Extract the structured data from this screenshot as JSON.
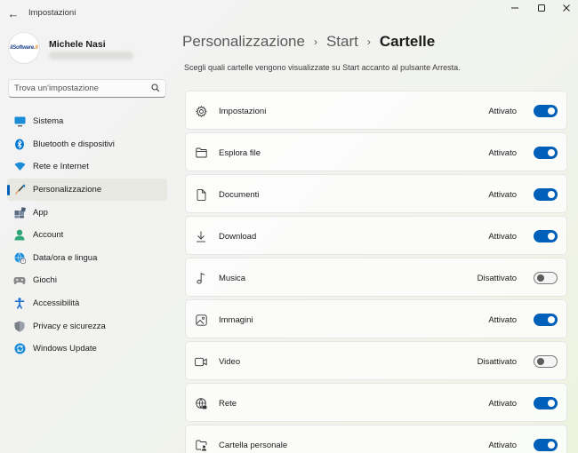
{
  "window": {
    "title": "Impostazioni",
    "back_icon": "arrow-left-icon"
  },
  "profile": {
    "name": "Michele Nasi",
    "logo_text": "ilSoftware",
    "logo_dot": ".it"
  },
  "search": {
    "placeholder": "Trova un'impostazione",
    "value": ""
  },
  "nav": {
    "items": [
      {
        "label": "Sistema",
        "icon": "monitor-icon",
        "color": "#0078d4"
      },
      {
        "label": "Bluetooth e dispositivi",
        "icon": "bluetooth-icon",
        "color": "#0078d4"
      },
      {
        "label": "Rete e Internet",
        "icon": "wifi-icon",
        "color": "#1a8cd8"
      },
      {
        "label": "Personalizzazione",
        "icon": "paintbrush-icon",
        "color": "#e07a2e",
        "active": true
      },
      {
        "label": "App",
        "icon": "apps-icon",
        "color": "#5a6b82"
      },
      {
        "label": "Account",
        "icon": "person-icon",
        "color": "#2fa57a"
      },
      {
        "label": "Data/ora e lingua",
        "icon": "globe-clock-icon",
        "color": "#1a8cd8"
      },
      {
        "label": "Giochi",
        "icon": "gamepad-icon",
        "color": "#8a8a8a"
      },
      {
        "label": "Accessibilità",
        "icon": "accessibility-icon",
        "color": "#1a6fd0"
      },
      {
        "label": "Privacy e sicurezza",
        "icon": "shield-icon",
        "color": "#7a7f88"
      },
      {
        "label": "Windows Update",
        "icon": "update-icon",
        "color": "#1a8cd8"
      }
    ]
  },
  "breadcrumb": {
    "level1": "Personalizzazione",
    "level2": "Start",
    "level3": "Cartelle",
    "separator": "›"
  },
  "subtitle": "Scegli quali cartelle vengono visualizzate su Start accanto al pulsante Arresta.",
  "folders": [
    {
      "label": "Impostazioni",
      "icon": "gear-icon",
      "state": "Attivato",
      "on": true
    },
    {
      "label": "Esplora file",
      "icon": "folder-icon",
      "state": "Attivato",
      "on": true
    },
    {
      "label": "Documenti",
      "icon": "document-icon",
      "state": "Attivato",
      "on": true
    },
    {
      "label": "Download",
      "icon": "download-icon",
      "state": "Attivato",
      "on": true
    },
    {
      "label": "Musica",
      "icon": "music-note-icon",
      "state": "Disattivato",
      "on": false
    },
    {
      "label": "Immagini",
      "icon": "image-icon",
      "state": "Attivato",
      "on": true
    },
    {
      "label": "Video",
      "icon": "video-icon",
      "state": "Disattivato",
      "on": false
    },
    {
      "label": "Rete",
      "icon": "network-globe-icon",
      "state": "Attivato",
      "on": true
    },
    {
      "label": "Cartella personale",
      "icon": "personal-folder-icon",
      "state": "Attivato",
      "on": true
    }
  ],
  "colors": {
    "accent": "#005fb8"
  }
}
